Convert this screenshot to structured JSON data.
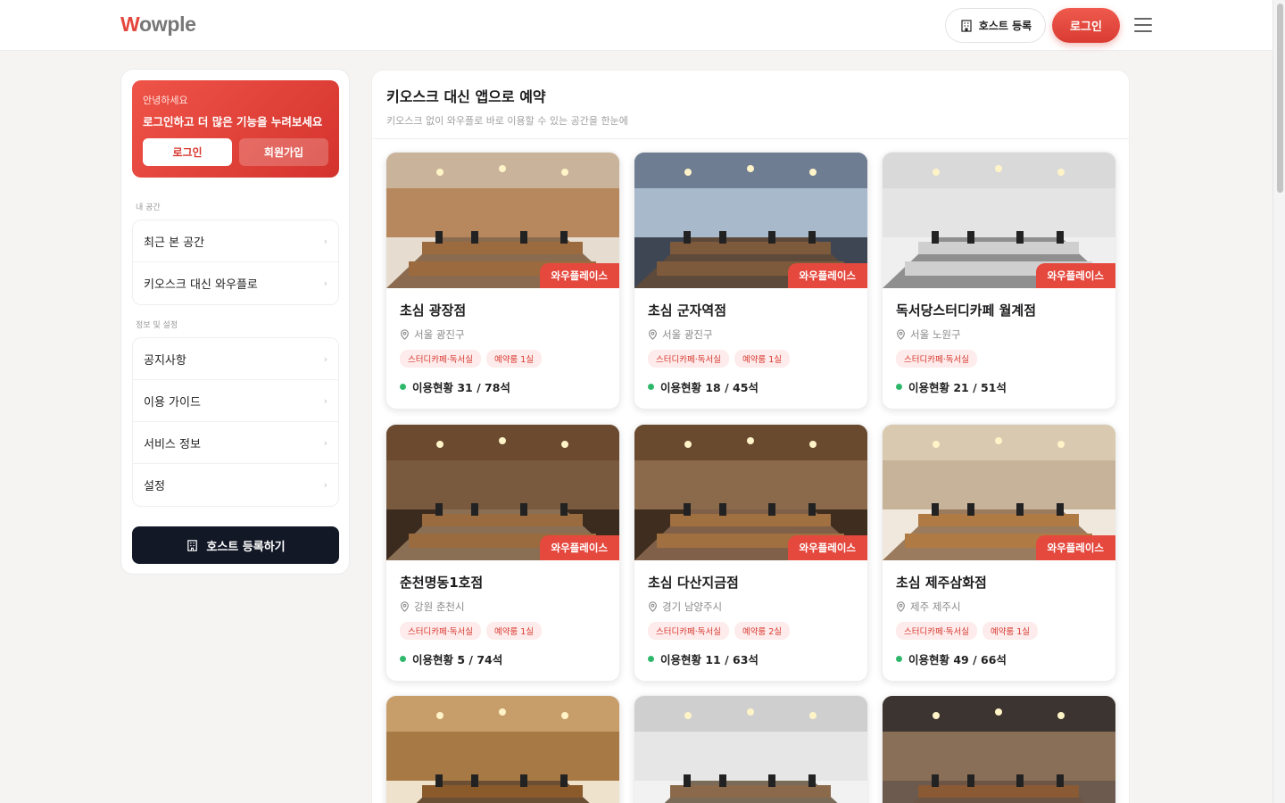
{
  "header": {
    "logo_first": "W",
    "logo_rest": "owple",
    "host_button": "호스트 등록",
    "login_button": "로그인"
  },
  "sidebar": {
    "promo": {
      "greeting": "안녕하세요",
      "message": "로그인하고 더 많은 기능을 누려보세요",
      "login": "로그인",
      "signup": "회원가입"
    },
    "my_space_label": "내 공간",
    "my_space_items": [
      "최근 본 공간",
      "키오스크 대신 와우플로"
    ],
    "info_label": "정보 및 설정",
    "info_items": [
      "공지사항",
      "이용 가이드",
      "서비스 정보",
      "설정"
    ],
    "host_cta": "호스트 등록하기"
  },
  "main": {
    "title": "키오스크 대신 앱으로 예약",
    "subtitle": "키오스크 없이 와우플로 바로 이용할 수 있는 공간을 한눈에"
  },
  "cards": [
    {
      "badge": "와우플레이스",
      "name": "초심 광장점",
      "location": "서울 광진구",
      "tags": [
        "스터디카페·독서실",
        "예약룸 1실"
      ],
      "status": "이용현황 31 / 78석"
    },
    {
      "badge": "와우플레이스",
      "name": "초심 군자역점",
      "location": "서울 광진구",
      "tags": [
        "스터디카페·독서실",
        "예약룸 1실"
      ],
      "status": "이용현황 18 / 45석"
    },
    {
      "badge": "와우플레이스",
      "name": "독서당스터디카페 월계점",
      "location": "서울 노원구",
      "tags": [
        "스터디카페·독서실"
      ],
      "status": "이용현황 21 / 51석"
    },
    {
      "badge": "와우플레이스",
      "name": "춘천명동1호점",
      "location": "강원 춘천시",
      "tags": [
        "스터디카페·독서실",
        "예약룸 1실"
      ],
      "status": "이용현황 5 / 74석"
    },
    {
      "badge": "와우플레이스",
      "name": "초심 다산지금점",
      "location": "경기 남양주시",
      "tags": [
        "스터디카페·독서실",
        "예약룸 2실"
      ],
      "status": "이용현황 11 / 63석"
    },
    {
      "badge": "와우플레이스",
      "name": "초심 제주삼화점",
      "location": "제주 제주시",
      "tags": [
        "스터디카페·독서실",
        "예약룸 1실"
      ],
      "status": "이용현황 49 / 66석"
    }
  ],
  "colors": {
    "accent": "#e5463d",
    "status_dot": "#2fb86b",
    "cta_dark": "#121826"
  }
}
